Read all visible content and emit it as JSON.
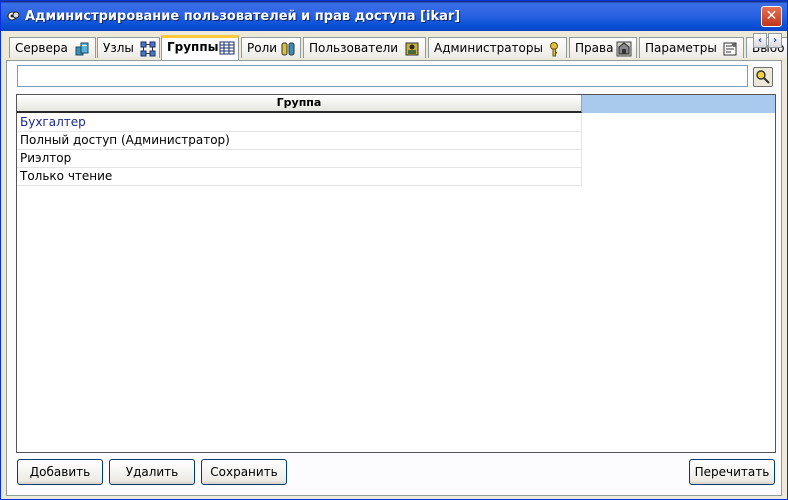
{
  "window": {
    "title": "Администрирование пользователей и прав доступа [ikar]",
    "close_label": "✕"
  },
  "tabs": [
    {
      "label": "Сервера",
      "icon": "servers-icon",
      "active": false
    },
    {
      "label": "Узлы",
      "icon": "nodes-icon",
      "active": false
    },
    {
      "label": "Группы",
      "icon": "groups-icon",
      "active": true
    },
    {
      "label": "Роли",
      "icon": "roles-icon",
      "active": false
    },
    {
      "label": "Пользователи",
      "icon": "users-icon",
      "active": false
    },
    {
      "label": "Администраторы",
      "icon": "administrators-key-icon",
      "active": false
    },
    {
      "label": "Права",
      "icon": "rights-icon",
      "active": false
    },
    {
      "label": "Параметры",
      "icon": "parameters-icon",
      "active": false
    },
    {
      "label": "Выбо",
      "icon": "",
      "active": false
    }
  ],
  "tab_scroll": {
    "left": "‹",
    "right": "›"
  },
  "search": {
    "value": "",
    "placeholder": ""
  },
  "grid": {
    "column_header": "Группа",
    "rows": [
      {
        "text": "Бухгалтер",
        "selected": true
      },
      {
        "text": "Полный доступ (Администратор)",
        "selected": false
      },
      {
        "text": "Риэлтор",
        "selected": false
      },
      {
        "text": "Только чтение",
        "selected": false
      }
    ]
  },
  "buttons": {
    "add": "Добавить",
    "delete": "Удалить",
    "save": "Сохранить",
    "refresh": "Перечитать"
  },
  "colors": {
    "title_bar": "#2c63e3",
    "grid_header": "#a9c9ed",
    "active_tab_accent": "#ffc73c",
    "selected_row_text": "#1d2a8c"
  }
}
